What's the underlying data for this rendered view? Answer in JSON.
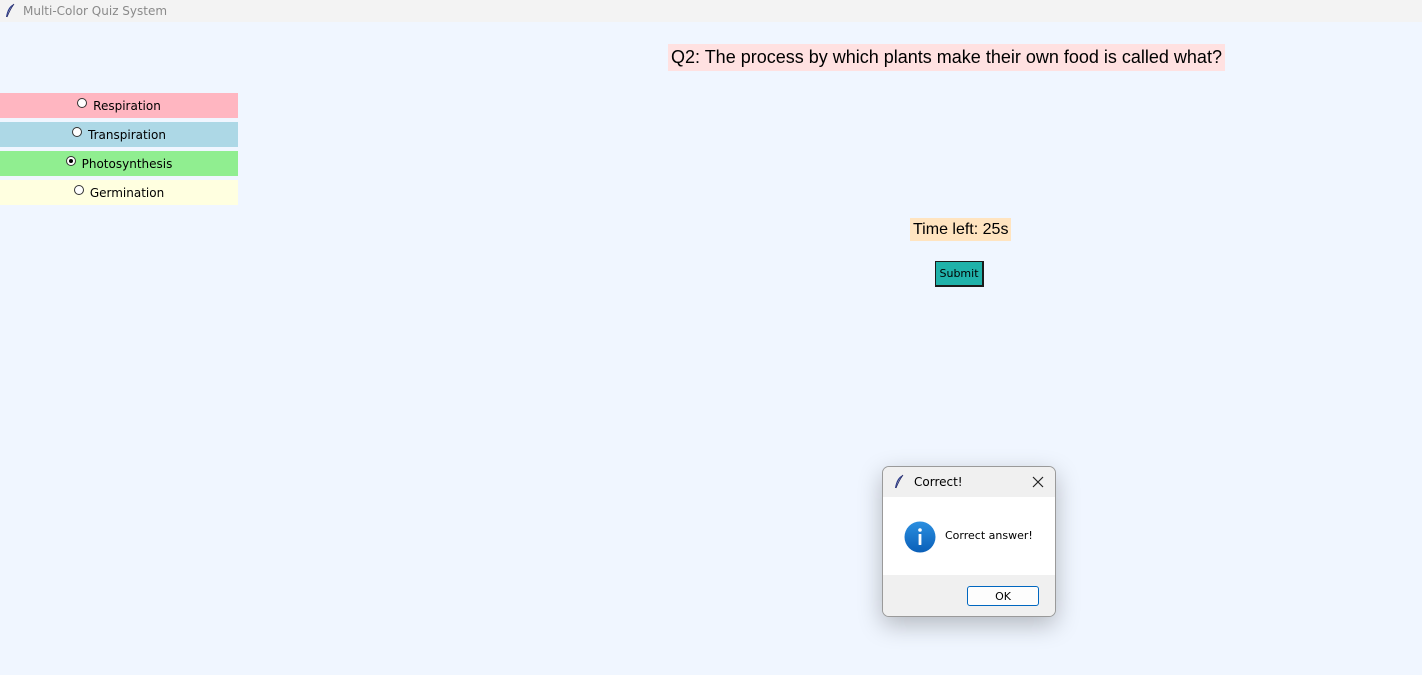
{
  "window": {
    "title": "Multi-Color Quiz System",
    "icon": "feather-icon"
  },
  "quiz": {
    "question": "Q2: The process by which plants make their own food is called what?",
    "timer_text": "Time left: 25s",
    "submit_label": "Submit",
    "selected": "Photosynthesis",
    "options": [
      {
        "label": "Respiration",
        "color": "#ffb6c1",
        "checked": false
      },
      {
        "label": "Transpiration",
        "color": "#add8e6",
        "checked": false
      },
      {
        "label": "Photosynthesis",
        "color": "#90ee90",
        "checked": true
      },
      {
        "label": "Germination",
        "color": "#ffffe0",
        "checked": false
      }
    ],
    "colors": {
      "background": "#f0f6ff",
      "question_bg": "#ffe1e1",
      "timer_bg": "#ffe4c0",
      "submit_bg": "#20b2aa"
    }
  },
  "dialog": {
    "title": "Correct!",
    "message": "Correct answer!",
    "ok_label": "OK",
    "icon": "info-icon",
    "close_icon": "close-icon"
  }
}
